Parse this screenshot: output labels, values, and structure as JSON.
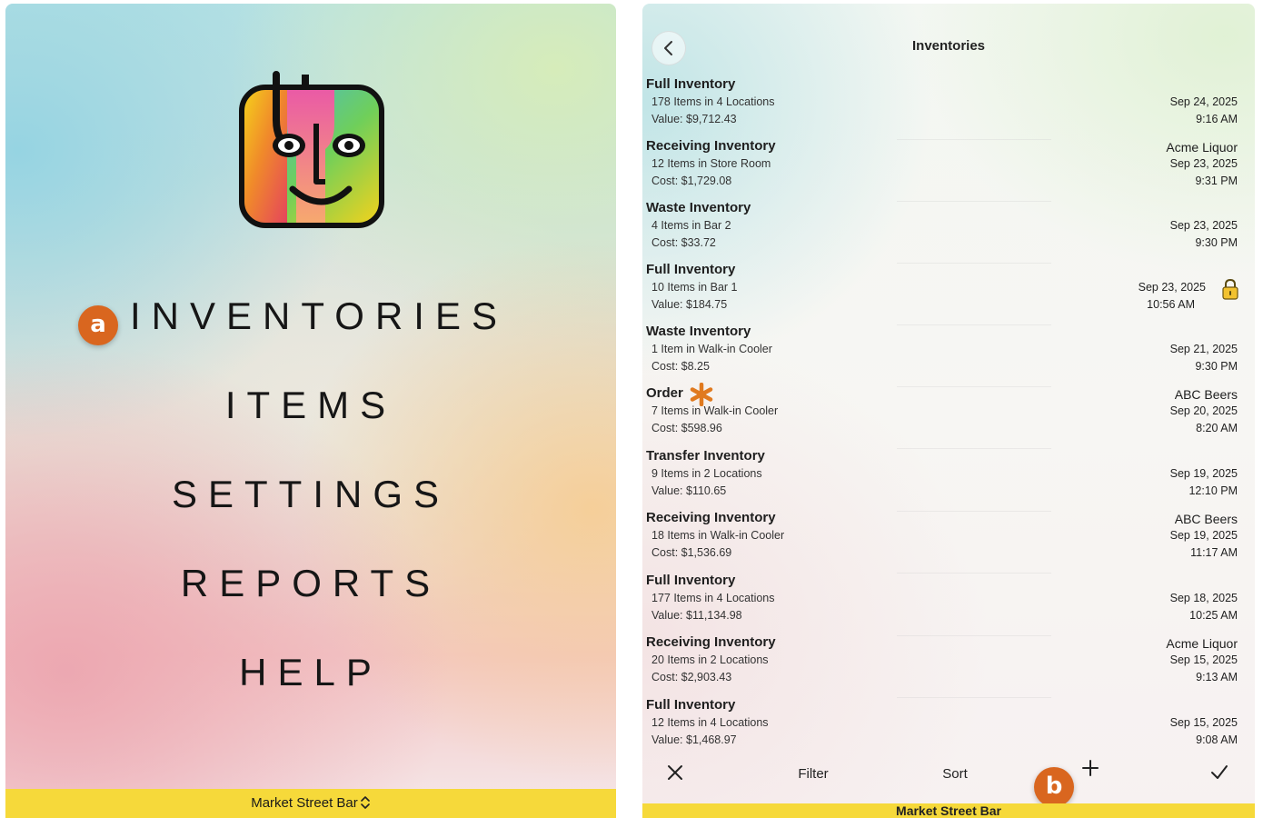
{
  "main_menu": {
    "items": [
      {
        "label": "INVENTORIES"
      },
      {
        "label": "ITEMS"
      },
      {
        "label": "SETTINGS"
      },
      {
        "label": "REPORTS"
      },
      {
        "label": "HELP"
      }
    ],
    "location": "Market Street Bar"
  },
  "annotations": {
    "a": "a",
    "b": "b"
  },
  "inventories": {
    "title": "Inventories",
    "rows": [
      {
        "title": "Full Inventory",
        "line1": "178 Items in 4 Locations",
        "line2": "Value: $9,712.43",
        "vendor": "",
        "date": "Sep 24, 2025",
        "time": "9:16 AM"
      },
      {
        "title": "Receiving Inventory",
        "line1": "12 Items in Store Room",
        "line2": "Cost: $1,729.08",
        "vendor": "Acme Liquor",
        "date": "Sep 23, 2025",
        "time": "9:31 PM"
      },
      {
        "title": "Waste Inventory",
        "line1": "4 Items in Bar 2",
        "line2": "Cost: $33.72",
        "vendor": "",
        "date": "Sep 23, 2025",
        "time": "9:30 PM"
      },
      {
        "title": "Full Inventory",
        "line1": "10 Items in Bar 1",
        "line2": "Value: $184.75",
        "vendor": "",
        "date": "Sep 23, 2025",
        "time": "10:56 AM",
        "locked": true
      },
      {
        "title": "Waste Inventory",
        "line1": "1 Item in Walk-in Cooler",
        "line2": "Cost: $8.25",
        "vendor": "",
        "date": "Sep 21, 2025",
        "time": "9:30 PM"
      },
      {
        "title": "Order",
        "line1": "7 Items in Walk-in Cooler",
        "line2": "Cost: $598.96",
        "vendor": "ABC Beers",
        "date": "Sep 20, 2025",
        "time": "8:20 AM",
        "asterisk": true
      },
      {
        "title": "Transfer Inventory",
        "line1": "9 Items in 2 Locations",
        "line2": "Value: $110.65",
        "vendor": "",
        "date": "Sep 19, 2025",
        "time": "12:10 PM"
      },
      {
        "title": "Receiving Inventory",
        "line1": "18 Items in Walk-in Cooler",
        "line2": "Cost: $1,536.69",
        "vendor": "ABC Beers",
        "date": "Sep 19, 2025",
        "time": "11:17 AM"
      },
      {
        "title": "Full Inventory",
        "line1": "177 Items in 4 Locations",
        "line2": "Value: $11,134.98",
        "vendor": "",
        "date": "Sep 18, 2025",
        "time": "10:25 AM"
      },
      {
        "title": "Receiving Inventory",
        "line1": "20 Items in 2 Locations",
        "line2": "Cost: $2,903.43",
        "vendor": "Acme Liquor",
        "date": "Sep 15, 2025",
        "time": "9:13 AM"
      },
      {
        "title": "Full Inventory",
        "line1": "12 Items in 4 Locations",
        "line2": "Value: $1,468.97",
        "vendor": "",
        "date": "Sep 15, 2025",
        "time": "9:08 AM"
      }
    ],
    "toolbar": {
      "filter": "Filter",
      "sort": "Sort",
      "close_glyph": "✕",
      "add_glyph": "+",
      "done_glyph": "✓"
    },
    "location": "Market Street Bar"
  },
  "colors": {
    "footer": "#f6d93a",
    "badge": "#d9661f",
    "asterisk": "#e07a1f",
    "lock": "#f2c230"
  },
  "icons": {
    "logo": "app-logo-face-icon",
    "back": "chevron-left-icon",
    "lock": "lock-icon",
    "asterisk": "asterisk-icon",
    "location_switch": "chevron-up-down-icon"
  }
}
